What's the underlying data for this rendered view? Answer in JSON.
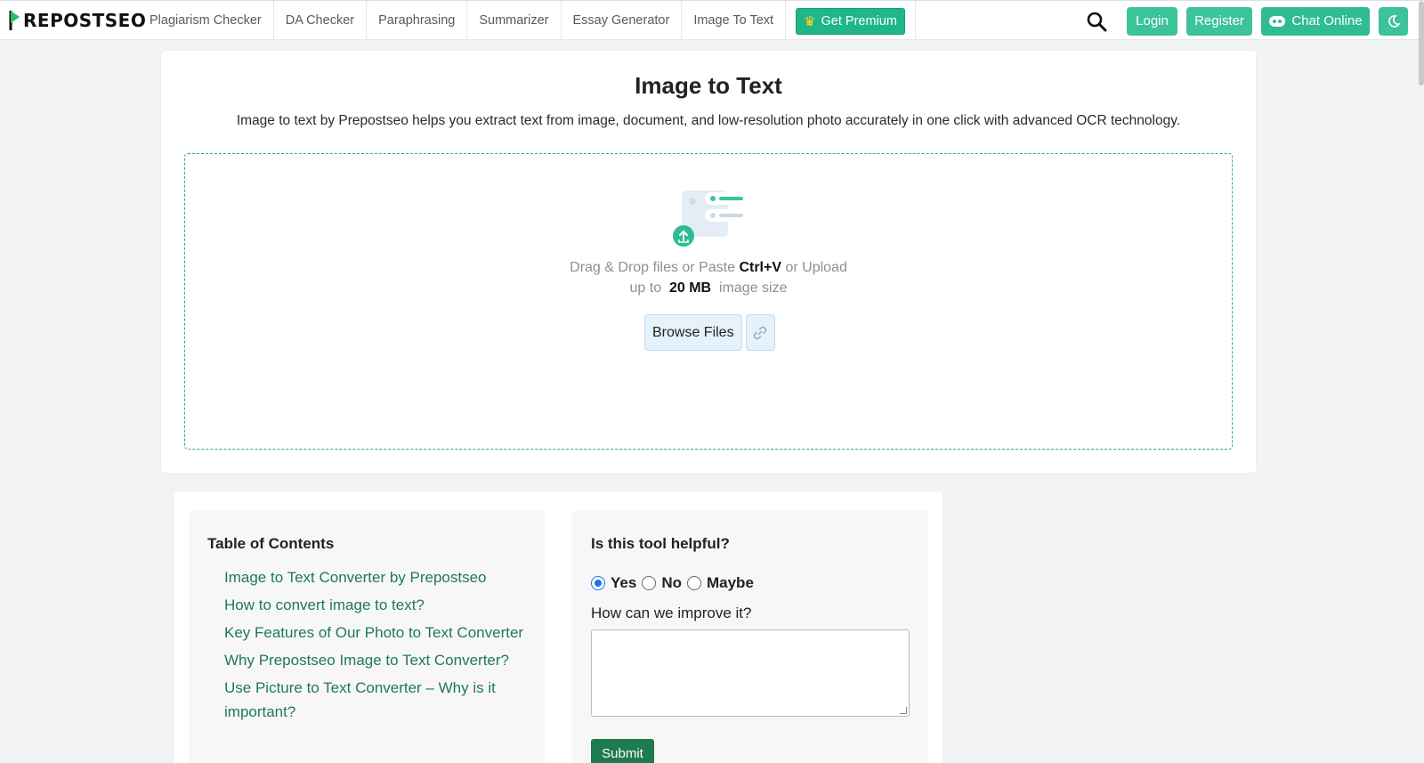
{
  "brand": {
    "logo_text": "REPOSTSEO",
    "accent": "#2fbc93",
    "link_color": "#1f7a54"
  },
  "nav": {
    "links": [
      {
        "label": "Plagiarism Checker"
      },
      {
        "label": "DA Checker"
      },
      {
        "label": "Paraphrasing"
      },
      {
        "label": "Summarizer"
      },
      {
        "label": "Essay Generator"
      },
      {
        "label": "Image To Text"
      }
    ],
    "premium_label": "Get Premium",
    "search_icon": "search-icon",
    "login_label": "Login",
    "register_label": "Register",
    "chat_label": "Chat Online",
    "dark_mode_icon": "moon-icon"
  },
  "tool": {
    "title": "Image to Text",
    "description": "Image to text by Prepostseo helps you extract text from image, document, and low-resolution photo accurately in one click with advanced OCR technology.",
    "drop_text_pre": "Drag & Drop files or Paste ",
    "drop_shortcut": "Ctrl+V",
    "drop_text_post": " or Upload",
    "size_pre": "up to ",
    "size_value": "20 MB",
    "size_post": " image size",
    "browse_label": "Browse Files",
    "link_icon": "link-icon"
  },
  "toc": {
    "title": "Table of Contents",
    "items": [
      "Image to Text Converter by Prepostseo",
      "How to convert image to text?",
      "Key Features of Our Photo to Text Converter",
      "Why Prepostseo Image to Text Converter?",
      "Use Picture to Text Converter – Why is it important?"
    ]
  },
  "feedback": {
    "title": "Is this tool helpful?",
    "options": [
      "Yes",
      "No",
      "Maybe"
    ],
    "selected": "Yes",
    "question": "How can we improve it?",
    "textarea_value": "",
    "submit_label": "Submit"
  }
}
